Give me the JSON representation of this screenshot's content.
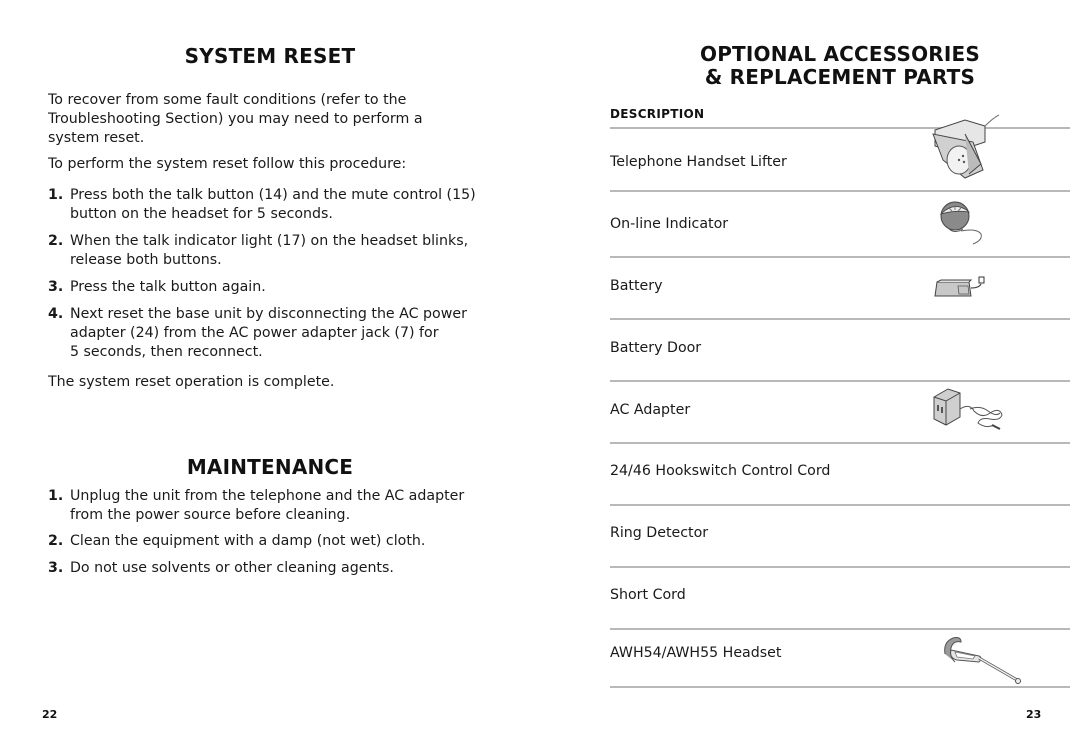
{
  "left_page": {
    "system_reset": {
      "title": "SYSTEM RESET",
      "intro": [
        "To recover from some fault conditions (refer to the",
        "Troubleshooting Section) you may need to perform a",
        "system reset."
      ],
      "procedure_intro": "To perform the system reset follow this procedure:",
      "steps": [
        {
          "num": "1.",
          "lines": [
            "Press both the talk button (14) and the mute control (15)",
            "button on the headset for 5 seconds."
          ]
        },
        {
          "num": "2.",
          "lines": [
            "When the talk indicator light (17) on the headset blinks,",
            "release both buttons."
          ]
        },
        {
          "num": "3.",
          "lines": [
            "Press the talk button again."
          ]
        },
        {
          "num": "4.",
          "lines": [
            "Next reset the base unit by disconnecting the AC power",
            "adapter (24) from the AC power adapter jack (7) for",
            "5 seconds, then reconnect."
          ]
        }
      ],
      "conclusion": "The system reset operation is complete."
    },
    "maintenance": {
      "title": "MAINTENANCE",
      "steps": [
        {
          "num": "1.",
          "lines": [
            "Unplug the unit from the telephone and the AC adapter",
            "from the power source before cleaning."
          ]
        },
        {
          "num": "2.",
          "lines": [
            "Clean the equipment with a damp (not wet) cloth."
          ]
        },
        {
          "num": "3.",
          "lines": [
            "Do not use solvents or other cleaning agents."
          ]
        }
      ]
    },
    "page_number": "22"
  },
  "right_page": {
    "title_line1": "OPTIONAL ACCESSORIES",
    "title_line2": "& REPLACEMENT PARTS",
    "column_header": "DESCRIPTION",
    "items": [
      {
        "label": "Telephone Handset Lifter",
        "icon": "handset-lifter-icon"
      },
      {
        "label": "On-line Indicator",
        "icon": "online-indicator-icon"
      },
      {
        "label": "Battery",
        "icon": "battery-icon"
      },
      {
        "label": "Battery Door",
        "icon": ""
      },
      {
        "label": "AC Adapter",
        "icon": "ac-adapter-icon"
      },
      {
        "label": "24/46 Hookswitch Control Cord",
        "icon": ""
      },
      {
        "label": "Ring Detector",
        "icon": ""
      },
      {
        "label": "Short Cord",
        "icon": ""
      },
      {
        "label": "AWH54/AWH55 Headset",
        "icon": "headset-icon"
      }
    ],
    "page_number": "23"
  }
}
